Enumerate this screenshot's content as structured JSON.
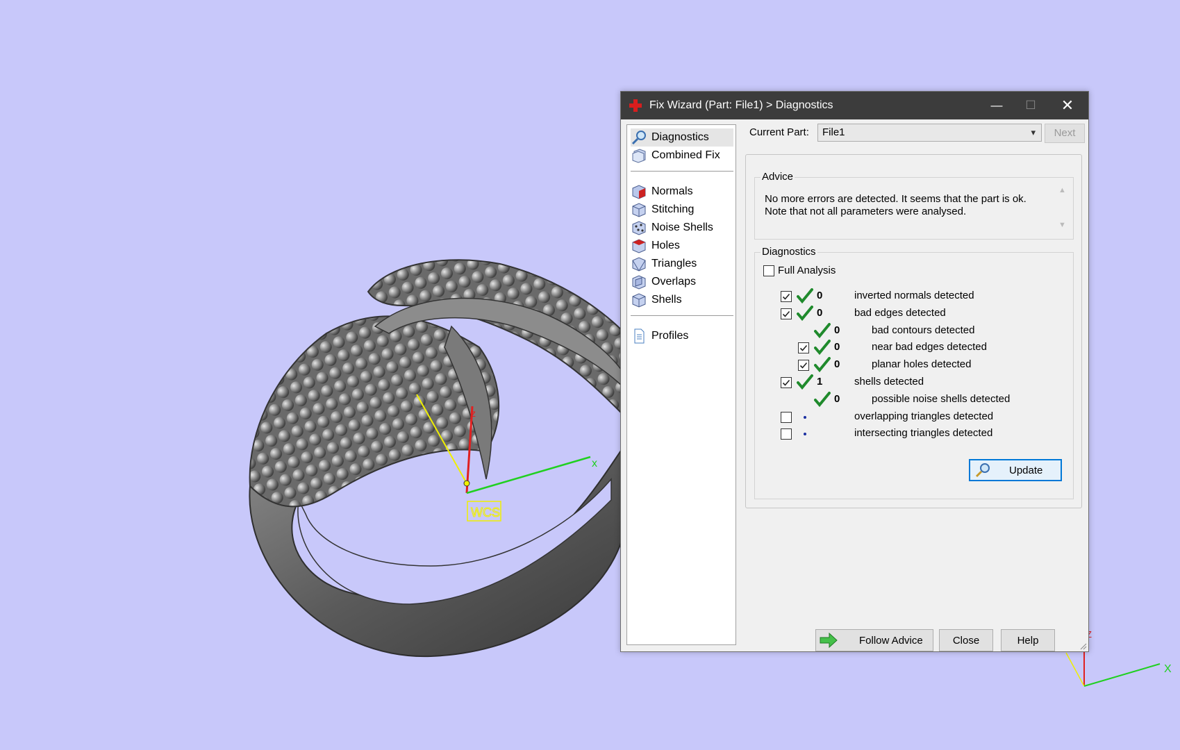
{
  "viewport": {
    "background": "#c8c8fa",
    "wcs_label": "WCS",
    "axis_x": "x",
    "axis_z": "z",
    "corner_axis_x": "X",
    "corner_axis_z": "Z"
  },
  "dialog": {
    "title": "Fix Wizard (Part: File1) > Diagnostics",
    "minimize_glyph": "—",
    "maximize_glyph": "☐",
    "close_glyph": "✕",
    "nav": {
      "items": [
        {
          "label": "Diagnostics",
          "icon": "magnifier-icon",
          "selected": true
        },
        {
          "label": "Combined Fix",
          "icon": "cube-stack-icon"
        },
        {
          "label": "Normals",
          "icon": "normals-cube-icon"
        },
        {
          "label": "Stitching",
          "icon": "stitching-cube-icon"
        },
        {
          "label": "Noise Shells",
          "icon": "noise-shells-icon"
        },
        {
          "label": "Holes",
          "icon": "holes-cube-icon"
        },
        {
          "label": "Triangles",
          "icon": "triangles-cube-icon"
        },
        {
          "label": "Overlaps",
          "icon": "overlaps-cube-icon"
        },
        {
          "label": "Shells",
          "icon": "shells-cube-icon"
        },
        {
          "label": "Profiles",
          "icon": "document-icon"
        }
      ]
    },
    "current_part_label": "Current Part:",
    "current_part_value": "File1",
    "next_label": "Next",
    "advice": {
      "title": "Advice",
      "line1": "No more errors are detected. It seems that the part is ok.",
      "line2": "Note that not all parameters were analysed."
    },
    "diagnostics": {
      "title": "Diagnostics",
      "full_analysis_label": "Full Analysis",
      "full_analysis_checked": false,
      "rows": [
        {
          "checked": true,
          "has_checkbox": true,
          "status": "ok",
          "count": "0",
          "label": "inverted normals detected",
          "indent": 0
        },
        {
          "checked": true,
          "has_checkbox": true,
          "status": "ok",
          "count": "0",
          "label": "bad edges detected",
          "indent": 0
        },
        {
          "checked": false,
          "has_checkbox": false,
          "status": "ok",
          "count": "0",
          "label": "bad contours detected",
          "indent": 1
        },
        {
          "checked": true,
          "has_checkbox": true,
          "status": "ok",
          "count": "0",
          "label": "near bad edges detected",
          "indent": 1
        },
        {
          "checked": true,
          "has_checkbox": true,
          "status": "ok",
          "count": "0",
          "label": "planar holes detected",
          "indent": 1
        },
        {
          "checked": true,
          "has_checkbox": true,
          "status": "ok",
          "count": "1",
          "label": "shells detected",
          "indent": 0
        },
        {
          "checked": false,
          "has_checkbox": false,
          "status": "ok",
          "count": "0",
          "label": "possible noise shells detected",
          "indent": 1
        },
        {
          "checked": false,
          "has_checkbox": true,
          "status": "pending",
          "count": "",
          "label": "overlapping triangles detected",
          "indent": 0
        },
        {
          "checked": false,
          "has_checkbox": true,
          "status": "pending",
          "count": "",
          "label": "intersecting triangles detected",
          "indent": 0
        }
      ],
      "update_label": "Update"
    },
    "follow_advice_label": "Follow Advice",
    "close_label": "Close",
    "help_label": "Help"
  },
  "colors": {
    "ok_tick": "#1f8a2c",
    "title_bar": "#3c3c3c",
    "accent": "#0078d7"
  }
}
